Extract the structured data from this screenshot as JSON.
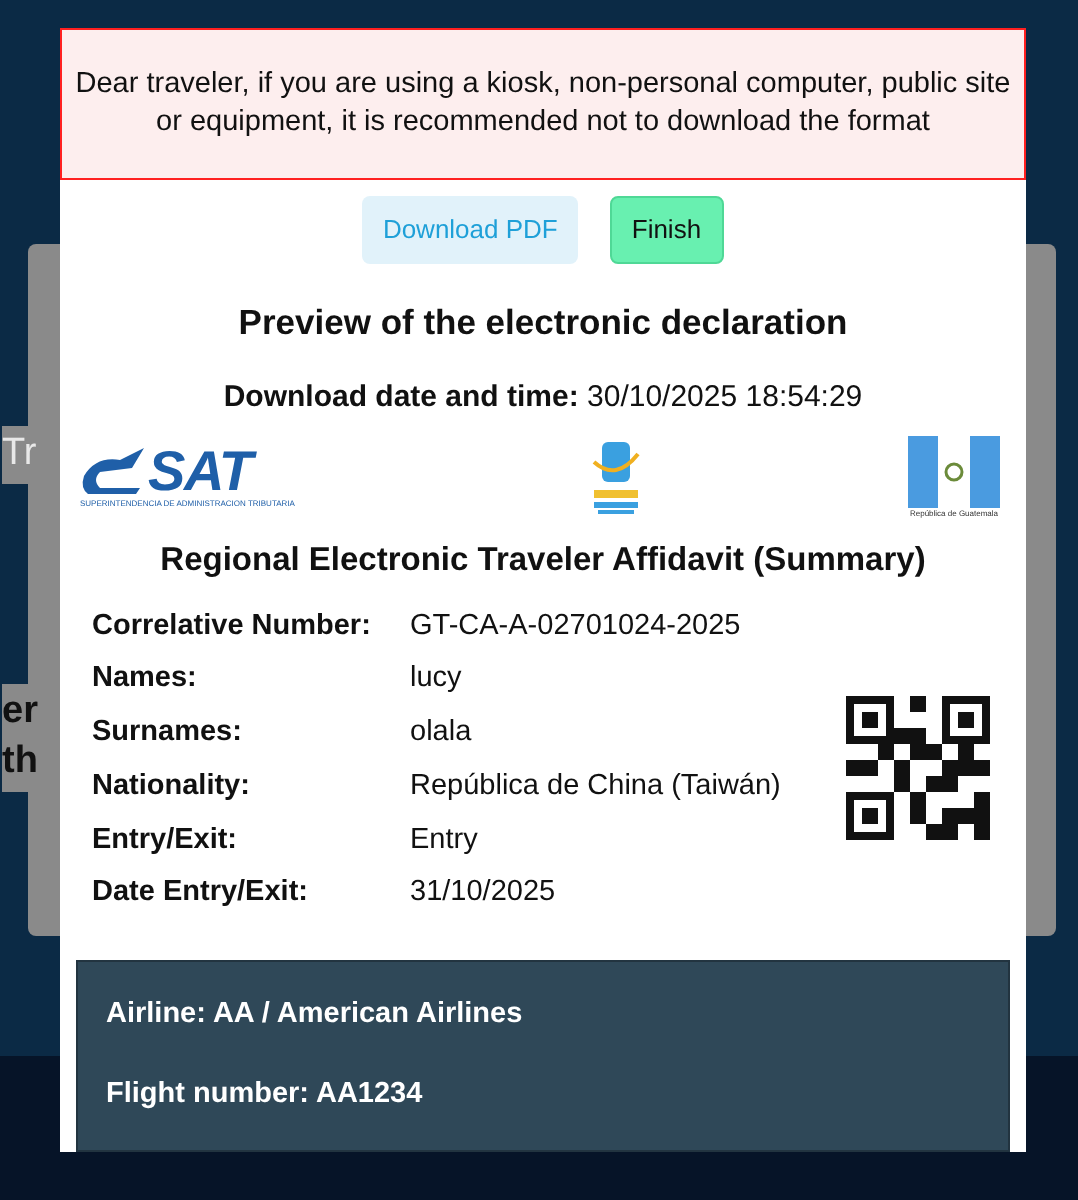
{
  "background": {
    "fragments": [
      {
        "text": "Tr",
        "kind": "plain"
      },
      {
        "text": "er",
        "kind": "bold"
      },
      {
        "text": "th",
        "kind": "bold"
      }
    ]
  },
  "modal": {
    "warning": "Dear traveler, if you are using a kiosk, non-personal computer, public site or equipment, it is recommended not to download the format",
    "buttons": [
      {
        "label": "Download PDF",
        "kind": "secondary"
      },
      {
        "label": "Finish",
        "kind": "primary"
      }
    ],
    "title": "Preview of the electronic declaration",
    "download": {
      "label": "Download date and time:",
      "value": "30/10/2025 18:54:29"
    },
    "logos": {
      "sat_text": "SAT",
      "sat_caption": "SUPERINTENDENCIA DE ADMINISTRACION TRIBUTARIA",
      "flag_caption": "República de Guatemala"
    },
    "summary_title": "Regional Electronic Traveler Affidavit (Summary)",
    "fields": [
      {
        "label": "Correlative Number:",
        "value": "GT-CA-A-02701024-2025"
      },
      {
        "label": "Names:",
        "value": "lucy"
      },
      {
        "label": "Surnames:",
        "value": "olala"
      },
      {
        "label": "Nationality:",
        "value": "República de China (Taiwán)"
      },
      {
        "label": "Entry/Exit:",
        "value": "Entry"
      },
      {
        "label": "Date Entry/Exit:",
        "value": "31/10/2025"
      }
    ],
    "flight": [
      {
        "label": "Airline:",
        "value": "AA / American Airlines"
      },
      {
        "label": "Flight number:",
        "value": "AA1234"
      }
    ]
  }
}
